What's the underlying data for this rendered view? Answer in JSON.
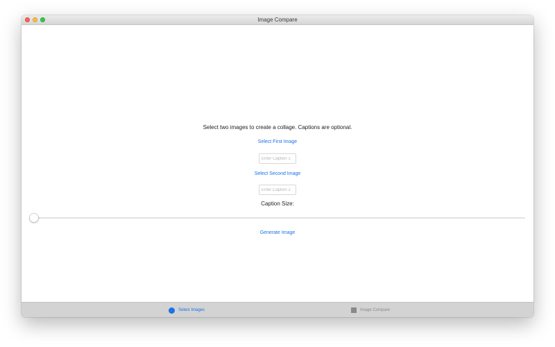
{
  "window": {
    "title": "Image Compare"
  },
  "main": {
    "instructions": "Select two images to create a collage. Captions are optional.",
    "select_first_label": "Select First Image",
    "caption1_placeholder": "Enter Caption 1",
    "caption1_value": "",
    "select_second_label": "Select Second Image",
    "caption2_placeholder": "Enter Caption 2",
    "caption2_value": "",
    "caption_size_label": "Caption Size:",
    "caption_size_value": 0,
    "generate_label": "Generate Image"
  },
  "tabs": [
    {
      "label": "Select Images",
      "icon": "circle-icon",
      "active": true
    },
    {
      "label": "Image Compare",
      "icon": "square-icon",
      "active": false
    }
  ],
  "colors": {
    "accent": "#1a73e8",
    "inactive": "#8a8a8a",
    "close": "#fc605c",
    "minimize": "#fdbc40",
    "maximize": "#34c84a"
  }
}
